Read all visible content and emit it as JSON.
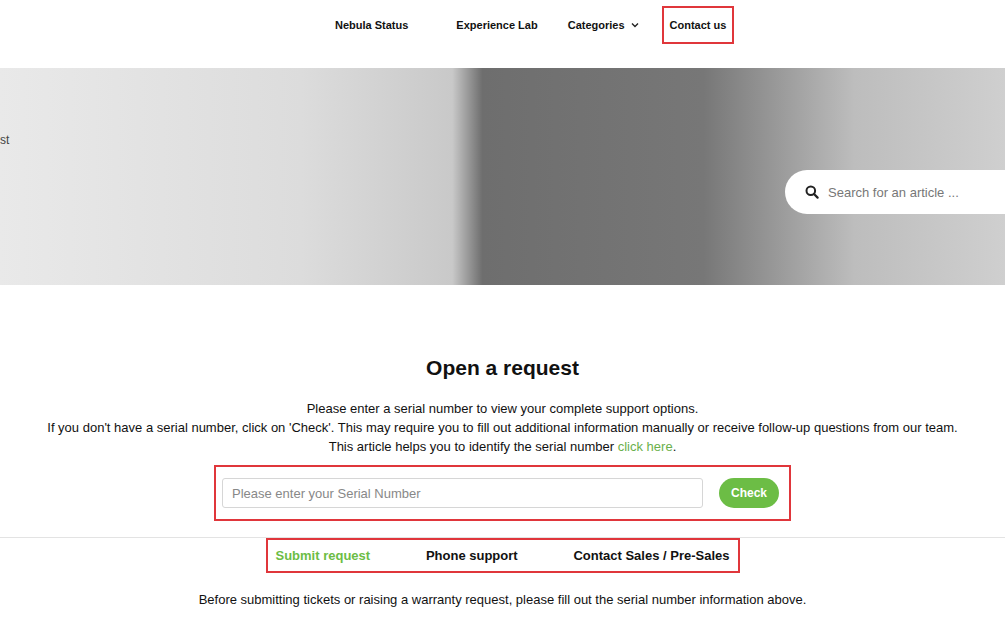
{
  "nav": {
    "items": [
      {
        "label": "Nebula Status",
        "highlighted": false,
        "dropdown": false
      },
      {
        "label": "Experience Lab",
        "highlighted": false,
        "dropdown": false
      },
      {
        "label": "Categories",
        "highlighted": false,
        "dropdown": true
      },
      {
        "label": "Contact us",
        "highlighted": true,
        "dropdown": false
      }
    ]
  },
  "hero": {
    "breadcrumb": "st",
    "search": {
      "placeholder": "Search for an article ..."
    }
  },
  "request": {
    "title": "Open a request",
    "lines": [
      "Please enter a serial number to view your complete support options.",
      "If you don't have a serial number, click on 'Check'. This may require you to fill out additional information manually or receive follow-up questions from our team."
    ],
    "help": {
      "prefix": "This article helps you to identify the serial number ",
      "link": "click here",
      "suffix": "."
    },
    "serial": {
      "placeholder": "Please enter your Serial Number",
      "button": "Check",
      "highlighted": true
    },
    "tabs": {
      "highlighted": true,
      "items": [
        {
          "label": "Submit request",
          "selected": true
        },
        {
          "label": "Phone support",
          "selected": false
        },
        {
          "label": "Contact Sales / Pre-Sales",
          "selected": false
        }
      ]
    },
    "note": "Before submitting tickets or raising a warranty request, please fill out the serial number information above."
  }
}
